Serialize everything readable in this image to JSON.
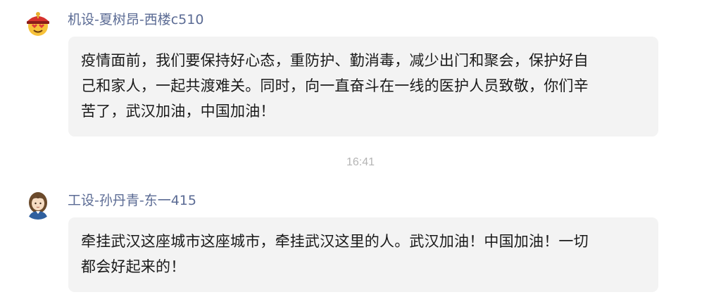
{
  "messages": [
    {
      "sender": "机设-夏树昂-西楼c510",
      "avatar_icon": "emperor-emoji-avatar",
      "text": "疫情面前，我们要保持好心态，重防护、勤消毒，减少出门和聚会，保护好自\n己和家人，一起共渡难关。同时，向一直奋斗在一线的医护人员致敬，你们辛\n苦了，武汉加油，中国加油！"
    },
    {
      "sender": "工设-孙丹青-东一415",
      "avatar_icon": "cartoon-girl-avatar",
      "text": "牵挂武汉这座城市这座城市，牵挂武汉这里的人。武汉加油！中国加油！一切\n都会好起来的！"
    }
  ],
  "timestamp": "16:41",
  "colors": {
    "sender_name": "#5b6b94",
    "bubble_bg": "#f3f3f3",
    "timestamp": "#b4b4b4"
  }
}
